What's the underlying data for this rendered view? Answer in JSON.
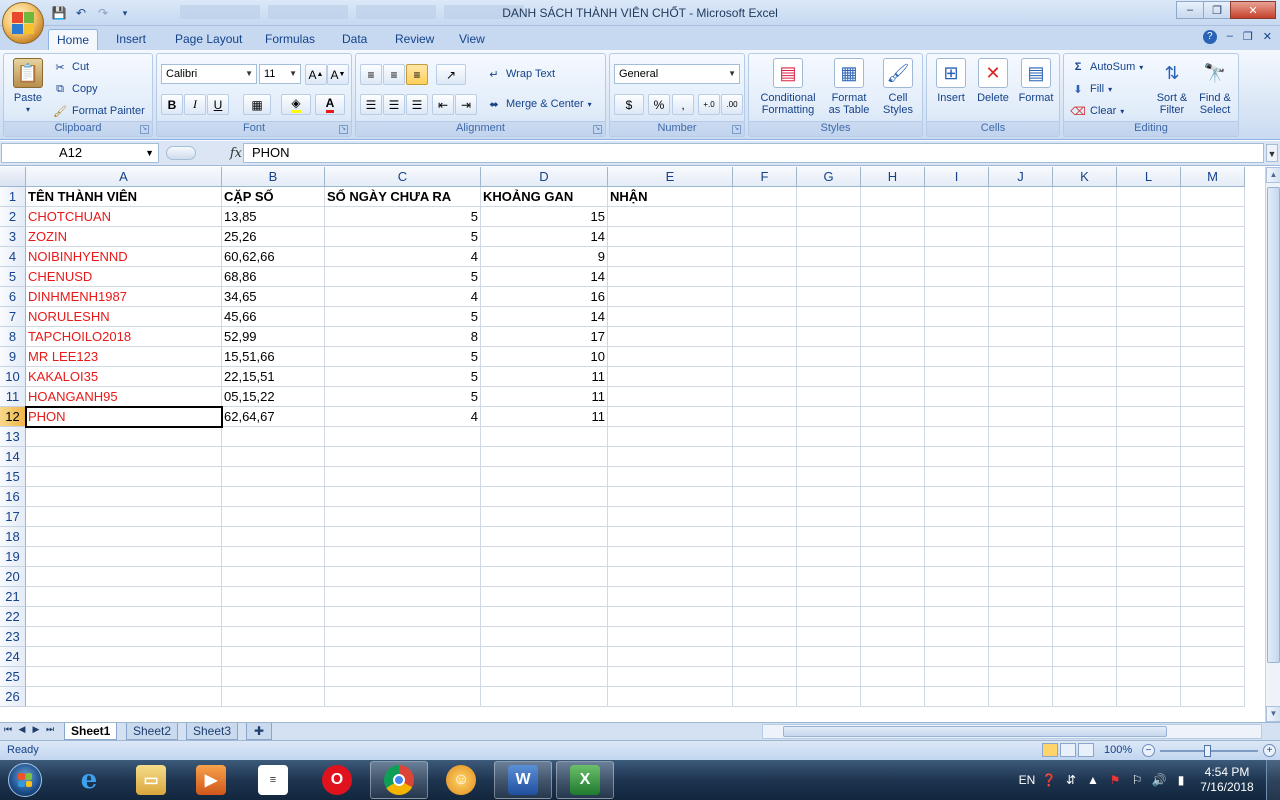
{
  "window": {
    "title": "DANH SÁCH THÀNH VIÊN CHỐT - Microsoft Excel",
    "controls": [
      "–",
      "❐",
      "✕"
    ]
  },
  "ribbon_tabs": [
    "Home",
    "Insert",
    "Page Layout",
    "Formulas",
    "Data",
    "Review",
    "View"
  ],
  "ribbon": {
    "clipboard": {
      "paste": "Paste",
      "cut": "Cut",
      "copy": "Copy",
      "format_painter": "Format Painter",
      "label": "Clipboard"
    },
    "font": {
      "name": "Calibri",
      "size": "11",
      "label": "Font",
      "bold": "B",
      "italic": "I",
      "underline": "U"
    },
    "alignment": {
      "wrap": "Wrap Text",
      "merge": "Merge & Center",
      "label": "Alignment"
    },
    "number": {
      "format": "General",
      "currency": "$",
      "percent": "%",
      "comma": ",",
      "label": "Number"
    },
    "styles": {
      "conditional": "Conditional",
      "conditional2": "Formatting",
      "format_table": "Format",
      "format_table2": "as Table",
      "cell_styles": "Cell",
      "cell_styles2": "Styles",
      "label": "Styles"
    },
    "cells": {
      "insert": "Insert",
      "delete": "Delete",
      "format": "Format",
      "label": "Cells"
    },
    "editing": {
      "autosum": "AutoSum",
      "fill": "Fill",
      "clear": "Clear",
      "sort": "Sort &",
      "sort2": "Filter",
      "find": "Find &",
      "find2": "Select",
      "label": "Editing"
    }
  },
  "formula_bar": {
    "name_box": "A12",
    "fx": "fx",
    "value": "PHON"
  },
  "columns": [
    "A",
    "B",
    "C",
    "D",
    "E",
    "F",
    "G",
    "H",
    "I",
    "J",
    "K",
    "L",
    "M"
  ],
  "headers": [
    "TÊN THÀNH VIÊN",
    "CẶP SỐ",
    "SỐ NGÀY CHƯA RA",
    "KHOẢNG GAN",
    "NHẬN"
  ],
  "rows": [
    {
      "name": "CHOTCHUAN",
      "pair": "13,85",
      "days": "5",
      "gan": "15"
    },
    {
      "name": "ZOZIN",
      "pair": "25,26",
      "days": "5",
      "gan": "14"
    },
    {
      "name": "NOIBINHYENND",
      "pair": "60,62,66",
      "days": "4",
      "gan": "9"
    },
    {
      "name": "CHENUSD",
      "pair": "68,86",
      "days": "5",
      "gan": "14"
    },
    {
      "name": "DINHMENH1987",
      "pair": "34,65",
      "days": "4",
      "gan": "16"
    },
    {
      "name": "NORULESHN",
      "pair": "45,66",
      "days": "5",
      "gan": "14"
    },
    {
      "name": "TAPCHOILO2018",
      "pair": "52,99",
      "days": "8",
      "gan": "17"
    },
    {
      "name": "MR LEE123",
      "pair": "15,51,66",
      "days": "5",
      "gan": "10"
    },
    {
      "name": "KAKALOI35",
      "pair": "22,15,51",
      "days": "5",
      "gan": "11"
    },
    {
      "name": "HOANGANH95",
      "pair": "05,15,22",
      "days": "5",
      "gan": "11"
    },
    {
      "name": "PHON",
      "pair": "62,64,67",
      "days": "4",
      "gan": "11"
    }
  ],
  "row_numbers": [
    "1",
    "2",
    "3",
    "4",
    "5",
    "6",
    "7",
    "8",
    "9",
    "10",
    "11",
    "12",
    "13",
    "14",
    "15",
    "16",
    "17",
    "18",
    "19",
    "20",
    "21",
    "22",
    "23",
    "24",
    "25",
    "26"
  ],
  "sheets": [
    "Sheet1",
    "Sheet2",
    "Sheet3"
  ],
  "status": {
    "ready": "Ready",
    "zoom": "100%"
  },
  "taskbar": {
    "lang": "EN",
    "time": "4:54 PM",
    "date": "7/16/2018"
  },
  "colors": {
    "name_red": "#e81919",
    "ribbon_bg": "#dbe7f6",
    "accent": "#15428b"
  }
}
